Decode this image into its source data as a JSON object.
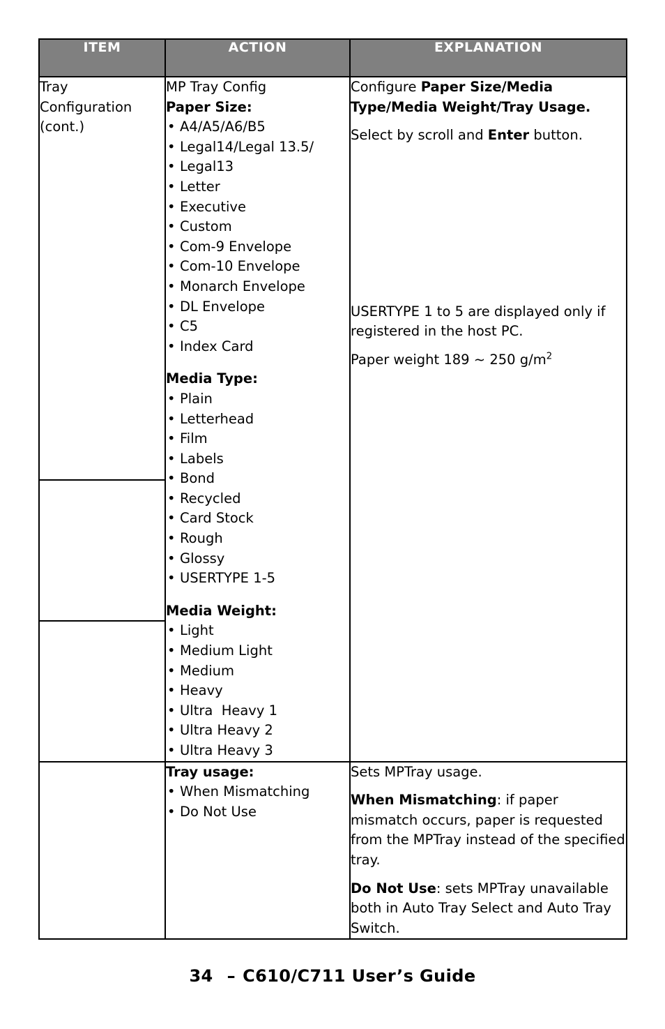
{
  "page": {
    "number": "34",
    "footer_dash": "–",
    "footer_title": "C610/C711 User’s Guide"
  },
  "table": {
    "headers": {
      "item": "ITEM",
      "action": "ACTION",
      "explanation": "EXPLANATION"
    },
    "header_bg": "#808080",
    "header_fg": "#ffffff",
    "border_color": "#000000",
    "rows": [
      {
        "item": "Tray Configuration (cont.)",
        "item_lines": [
          "Tray",
          "Configuration",
          "(cont.)"
        ],
        "action": {
          "intro": "MP Tray Config",
          "heading": "Paper Size:",
          "bullets": [
            "A4/A5/A6/B5",
            "Legal14/Legal 13.5/",
            "Legal13",
            "Letter",
            "Executive",
            "Custom",
            "Com-9 Envelope",
            "Com-10 Envelope",
            "Monarch Envelope",
            "DL Envelope",
            "C5",
            "Index Card"
          ]
        },
        "explanation": {
          "para1_plain1": "Configure ",
          "para1_bold": "Paper Size/Media Type/Media Weight/Tray Usage.",
          "para2_plain1": "Select by scroll and ",
          "para2_bold": "Enter",
          "para2_plain2": " button."
        }
      },
      {
        "item": "",
        "action": {
          "heading": "Media Type:",
          "bullets": [
            "Plain",
            "Letterhead",
            "Film",
            "Labels",
            "Bond",
            "Recycled",
            "Card Stock",
            "Rough",
            "Glossy",
            "USERTYPE 1-5"
          ]
        },
        "explanation": {
          "para1": "USERTYPE 1 to 5 are displayed only if registered in the host PC.",
          "para2_pre": "Paper weight 189 ~ 250 g/m",
          "para2_sup": "2"
        }
      },
      {
        "item": "",
        "action": {
          "heading": " Media Weight:",
          "bullets": [
            "Light",
            "Medium Light",
            "Medium",
            "Heavy",
            "Ultra  Heavy 1",
            "Ultra Heavy 2",
            "Ultra Heavy 3"
          ]
        },
        "explanation": {
          "empty": ""
        }
      },
      {
        "item": "",
        "action": {
          "heading": "Tray usage:",
          "bullets": [
            "When Mismatching",
            "Do Not Use"
          ]
        },
        "explanation": {
          "para1": "Sets MPTray usage.",
          "para2_bold": "When Mismatching",
          "para2_plain": ": if paper mismatch occurs, paper is requested from the MPTray instead of the specified tray.",
          "para3_bold": "Do Not Use",
          "para3_plain": ": sets MPTray unavailable both in Auto Tray Select and Auto Tray Switch."
        }
      }
    ]
  }
}
